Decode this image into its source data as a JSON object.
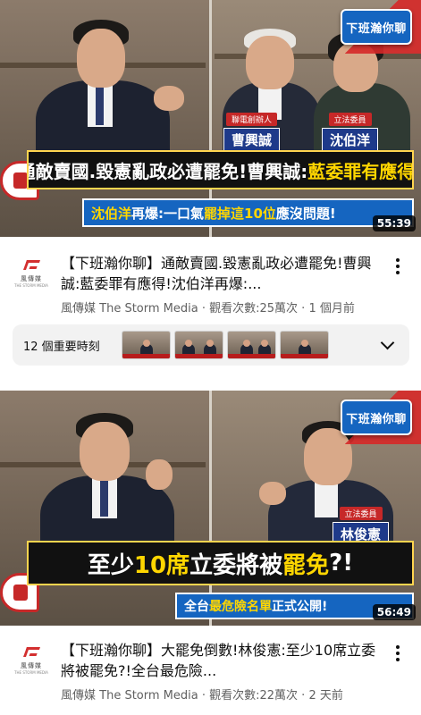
{
  "videos": [
    {
      "thumbnail": {
        "show_badge": "下班瀚你聊",
        "guests": [
          {
            "role": "聯電創辦人",
            "name": "曹興誠"
          },
          {
            "role": "立法委員",
            "name": "沈伯洋"
          }
        ],
        "headline_parts": [
          "通敵賣國.毀憲亂政必遭罷免!曹興誠:",
          "藍委罪有應得!"
        ],
        "subline_parts": [
          "沈伯洋",
          "再爆:一口氣",
          "罷掉這10位",
          "應沒問題!"
        ],
        "duration": "55:39"
      },
      "title": "【下班瀚你聊】通敵賣國.毀憲亂政必遭罷免!曹興誠:藍委罪有應得!沈伯洋再爆:...",
      "channel": "風傳媒 The Storm Media",
      "views": "觀看次數:25萬次",
      "age": "1 個月前",
      "key_moments_label": "12 個重要時刻"
    },
    {
      "thumbnail": {
        "show_badge": "下班瀚你聊",
        "guests": [
          {
            "role": "立法委員",
            "name": "林俊憲"
          }
        ],
        "headline_parts": [
          "至少",
          "10席",
          "立委將被",
          "罷免",
          "?!"
        ],
        "subline_parts": [
          "全台",
          "最危險名單",
          "正式公開!"
        ],
        "duration": "56:49"
      },
      "title": "【下班瀚你聊】大罷免倒數!林俊憲:至少10席立委將被罷免?!全台最危險...",
      "channel": "風傳媒 The Storm Media",
      "views": "觀看次數:22萬次",
      "age": "2 天前"
    }
  ],
  "channel_logo": {
    "text": "風傳媒",
    "sub": "THE STORM MEDIA"
  },
  "meta_separator": " · ",
  "icons": {
    "more": "more-vert-icon",
    "expand": "chevron-down-icon",
    "logo": "storm-media-logo-icon"
  },
  "colors": {
    "banner_bg": "#111111",
    "banner_accent": "#ffd600",
    "subline_bg": "#1565c0",
    "name_bg": "#1e3a8a",
    "role_bg": "#c62828"
  }
}
